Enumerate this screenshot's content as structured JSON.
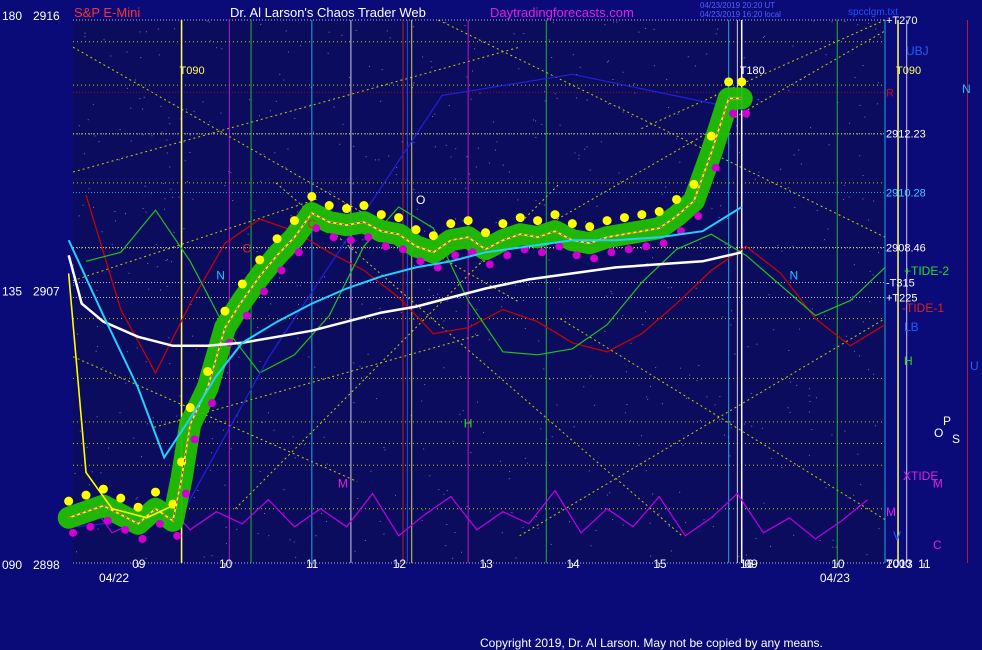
{
  "header": {
    "instrument": "S&P E-Mini",
    "site_title": "Dr. Al Larson's Chaos Trader Web",
    "site_url": "Daytradingforecasts.com",
    "stamp_line1": "04/23/2019 20:20 UT",
    "stamp_line2": "04/23/2019 16:20 local",
    "file_name": "spcclgm.txt"
  },
  "copyright": "Copyright 2019, Dr. Al Larson. May not be copied by any means.",
  "colors": {
    "background": "#0a0a78",
    "plot_background": "#0c0c5e",
    "price_bars": "#ffff00",
    "green_band": "#22c000",
    "magenta_close": "#d000d0",
    "white_avg": "#ffffff",
    "cyan_avg": "#20d0ff",
    "red_line": "#d00000",
    "green_line": "#20c020",
    "blue_line": "#2020e0",
    "purple_line": "#c000e0",
    "grid_yellow": "#c8c800"
  },
  "chart_data": {
    "type": "line",
    "title": "S&P E-Mini",
    "y_axis_labels": [
      {
        "angle": "180",
        "price": "2916",
        "value": 2916
      },
      {
        "angle": "135",
        "price": "2907",
        "value": 2907
      },
      {
        "angle": "090",
        "price": "2898",
        "value": 2898
      }
    ],
    "ylim": [
      2898,
      2916
    ],
    "x_range_hours": [
      8.25,
      17.6
    ],
    "x_ticks": [
      {
        "label": "09",
        "x": 9.0
      },
      {
        "label": "10",
        "x": 10.0
      },
      {
        "label": "11",
        "x": 11.0
      },
      {
        "label": "12",
        "x": 12.0
      },
      {
        "label": "13",
        "x": 13.0
      },
      {
        "label": "14",
        "x": 14.0
      },
      {
        "label": "15",
        "x": 15.0
      },
      {
        "label": "16",
        "x": 16.0
      },
      {
        "label": "09",
        "x": 8.25
      },
      {
        "label": "10",
        "x": 9.25
      },
      {
        "label": "11",
        "x": 10.25
      },
      {
        "label": "12",
        "x": 11.25
      },
      {
        "label": "13",
        "x": 12.25
      },
      {
        "label": "14",
        "x": 13.25
      },
      {
        "label": "15",
        "x": 14.25
      },
      {
        "label": "16",
        "x": 15.25
      }
    ],
    "dates": [
      {
        "label": "04/22",
        "x": 8.55
      },
      {
        "label": "04/23",
        "x": 16.85
      }
    ],
    "price_levels": [
      {
        "label": "+T270",
        "value": 2916.0,
        "color": "#ffffff"
      },
      {
        "label": "R",
        "value": 2913.6,
        "color": "#e00000"
      },
      {
        "label": "2912.23",
        "value": 2912.23,
        "color": "#ffffff"
      },
      {
        "label": "2910.28",
        "value": 2910.28,
        "color": "#40d0ff"
      },
      {
        "label": "2908.46",
        "value": 2908.46,
        "color": "#ffffff"
      },
      {
        "label": "-T315",
        "value": 2907.3,
        "color": "#ffffff"
      },
      {
        "label": "+T225",
        "value": 2906.8,
        "color": "#ffffff"
      },
      {
        "label": "T000",
        "value": 2898.0,
        "color": "#ffffff"
      }
    ],
    "right_labels": [
      {
        "label": "UBJ",
        "color": "#2060ff"
      },
      {
        "label": "N",
        "color": "#20c0ff"
      },
      {
        "label": "+TIDE-2",
        "color": "#20e020"
      },
      {
        "label": "-TIDE-1",
        "color": "#e02020"
      },
      {
        "label": "LB",
        "color": "#2060ff"
      },
      {
        "label": "H",
        "color": "#20e020"
      },
      {
        "label": "U",
        "color": "#2060ff"
      },
      {
        "label": "O",
        "color": "#ffffff"
      },
      {
        "label": "P",
        "color": "#ffffff"
      },
      {
        "label": "S",
        "color": "#ffffff"
      },
      {
        "label": "XTIDE",
        "color": "#e020e0"
      },
      {
        "label": "M",
        "color": "#e020e0"
      },
      {
        "label": "V",
        "color": "#2060ff"
      },
      {
        "label": "C",
        "color": "#e020e0"
      },
      {
        "label": "2013",
        "color": "#ffffff"
      }
    ],
    "vertical_markers": [
      {
        "label": "T090",
        "x": 9.5,
        "color": "#ffff60"
      },
      {
        "label": "T180",
        "x": 15.95,
        "color": "#ffffff"
      },
      {
        "label": "T090",
        "x": 10.2,
        "color": "#ffff60"
      }
    ],
    "planet_markers": [
      {
        "label": "C",
        "x": 10.95,
        "y": 2909.1,
        "color": "#e02020"
      },
      {
        "label": "O",
        "x": 12.2,
        "y": 2909.9,
        "color": "#ffffff"
      },
      {
        "label": "N",
        "x": 9.9,
        "y": 2907.4,
        "color": "#20c0ff"
      },
      {
        "label": "H",
        "x": 12.75,
        "y": 2902.5,
        "color": "#20e020"
      },
      {
        "label": "M",
        "x": 11.3,
        "y": 2900.5,
        "color": "#e020e0"
      },
      {
        "label": "C",
        "x": 10.2,
        "y": 2908.3,
        "color": "#e02020"
      },
      {
        "label": "O",
        "x": 11.85,
        "y": 2909.9,
        "color": "#ffffff"
      },
      {
        "label": "P",
        "x": 11.9,
        "y": 2908.1,
        "color": "#ffffff"
      },
      {
        "label": "N",
        "x": 8.95,
        "y": 2907.4,
        "color": "#20c0ff"
      },
      {
        "label": "H",
        "x": 12.3,
        "y": 2902.5,
        "color": "#20e020"
      },
      {
        "label": "M",
        "x": 10.6,
        "y": 2900.5,
        "color": "#e020e0"
      }
    ],
    "series": [
      {
        "kind": "price_close",
        "x": [
          8.2,
          8.4,
          8.6,
          8.8,
          9.0,
          9.2,
          9.4,
          9.5,
          9.6,
          9.8,
          10.0,
          10.2,
          10.4,
          10.6,
          10.8,
          11.0,
          11.2,
          11.4,
          11.6,
          11.8,
          12.0,
          12.2,
          12.4,
          12.6,
          12.8,
          13.0,
          13.2,
          13.4,
          13.6,
          13.8,
          14.0,
          14.2,
          14.4,
          14.6,
          14.8,
          15.0,
          15.2,
          15.4,
          15.6,
          15.8,
          15.95
        ],
        "y": [
          2899.5,
          2899.7,
          2899.9,
          2899.6,
          2899.3,
          2899.8,
          2899.4,
          2900.8,
          2902.6,
          2903.8,
          2905.8,
          2906.7,
          2907.5,
          2908.2,
          2908.8,
          2909.6,
          2909.3,
          2909.2,
          2909.3,
          2909.0,
          2908.9,
          2908.5,
          2908.3,
          2908.7,
          2908.8,
          2908.4,
          2908.7,
          2908.9,
          2908.8,
          2909.0,
          2908.7,
          2908.6,
          2908.8,
          2908.9,
          2909.0,
          2909.1,
          2909.5,
          2910.0,
          2911.6,
          2913.4,
          2913.4
        ]
      },
      {
        "kind": "avg_white",
        "x": [
          8.2,
          8.35,
          8.6,
          9.0,
          9.4,
          9.8,
          10.2,
          10.6,
          11.0,
          11.4,
          11.8,
          12.2,
          12.6,
          13.0,
          13.5,
          14.0,
          14.5,
          15.0,
          15.5,
          15.95
        ],
        "y": [
          2908.2,
          2906.6,
          2906.0,
          2905.5,
          2905.2,
          2905.2,
          2905.3,
          2905.5,
          2905.7,
          2906.0,
          2906.3,
          2906.5,
          2906.8,
          2907.1,
          2907.4,
          2907.6,
          2907.8,
          2907.9,
          2908.0,
          2908.3
        ]
      },
      {
        "kind": "avg_cyan",
        "x": [
          8.2,
          8.6,
          9.0,
          9.3,
          9.6,
          9.9,
          10.2,
          10.6,
          11.0,
          11.4,
          11.8,
          12.2,
          12.6,
          13.0,
          13.5,
          14.0,
          14.5,
          15.0,
          15.5,
          15.95
        ],
        "y": [
          2908.7,
          2906.2,
          2903.8,
          2901.5,
          2902.8,
          2904.2,
          2905.3,
          2906.0,
          2906.6,
          2907.1,
          2907.5,
          2907.8,
          2908.0,
          2908.3,
          2908.5,
          2908.7,
          2908.7,
          2908.8,
          2909.0,
          2909.8
        ]
      },
      {
        "kind": "red_cycle",
        "x": [
          8.4,
          8.8,
          9.2,
          9.6,
          10.0,
          10.4,
          10.8,
          11.2,
          11.6,
          12.0,
          12.4,
          12.8,
          13.2,
          13.6,
          14.0,
          14.4,
          14.8,
          15.2,
          15.6,
          16.0,
          16.4,
          16.8,
          17.2,
          17.6
        ],
        "y": [
          2910.2,
          2906.4,
          2904.3,
          2906.6,
          2908.6,
          2909.4,
          2909.0,
          2908.3,
          2907.7,
          2906.8,
          2905.6,
          2905.8,
          2906.4,
          2906.0,
          2905.3,
          2905.0,
          2905.6,
          2906.6,
          2907.7,
          2908.5,
          2907.6,
          2906.1,
          2905.2,
          2905.9
        ]
      },
      {
        "kind": "green_cycle",
        "x": [
          8.4,
          8.8,
          9.2,
          9.6,
          10.0,
          10.4,
          10.8,
          11.2,
          11.6,
          12.0,
          12.4,
          12.8,
          13.2,
          13.6,
          14.0,
          14.4,
          14.8,
          15.2,
          15.6,
          16.0,
          16.4,
          16.8,
          17.2,
          17.6
        ],
        "y": [
          2908.0,
          2908.3,
          2909.7,
          2908.0,
          2905.8,
          2904.3,
          2904.9,
          2906.2,
          2908.5,
          2909.8,
          2909.1,
          2906.7,
          2905.0,
          2904.9,
          2905.1,
          2905.9,
          2907.3,
          2908.4,
          2908.9,
          2908.2,
          2907.2,
          2906.2,
          2906.7,
          2907.8
        ]
      },
      {
        "kind": "xtide",
        "x": [
          8.4,
          8.7,
          9.0,
          9.3,
          9.6,
          9.9,
          10.2,
          10.5,
          10.8,
          11.1,
          11.4,
          11.7,
          12.0,
          12.3,
          12.6,
          12.9,
          13.2,
          13.5,
          13.8,
          14.1,
          14.4,
          14.7,
          15.0,
          15.3,
          15.6,
          15.9,
          16.2,
          16.5,
          16.8,
          17.1,
          17.4
        ],
        "y": [
          2900.2,
          2899.0,
          2899.4,
          2900.0,
          2899.1,
          2899.7,
          2899.3,
          2900.1,
          2899.2,
          2899.8,
          2899.2,
          2900.3,
          2898.9,
          2899.6,
          2900.2,
          2899.1,
          2899.7,
          2899.3,
          2900.4,
          2899.0,
          2899.8,
          2899.2,
          2900.2,
          2898.9,
          2899.5,
          2900.3,
          2899.0,
          2899.5,
          2898.8,
          2899.4,
          2900.1
        ]
      }
    ],
    "grid": true
  }
}
